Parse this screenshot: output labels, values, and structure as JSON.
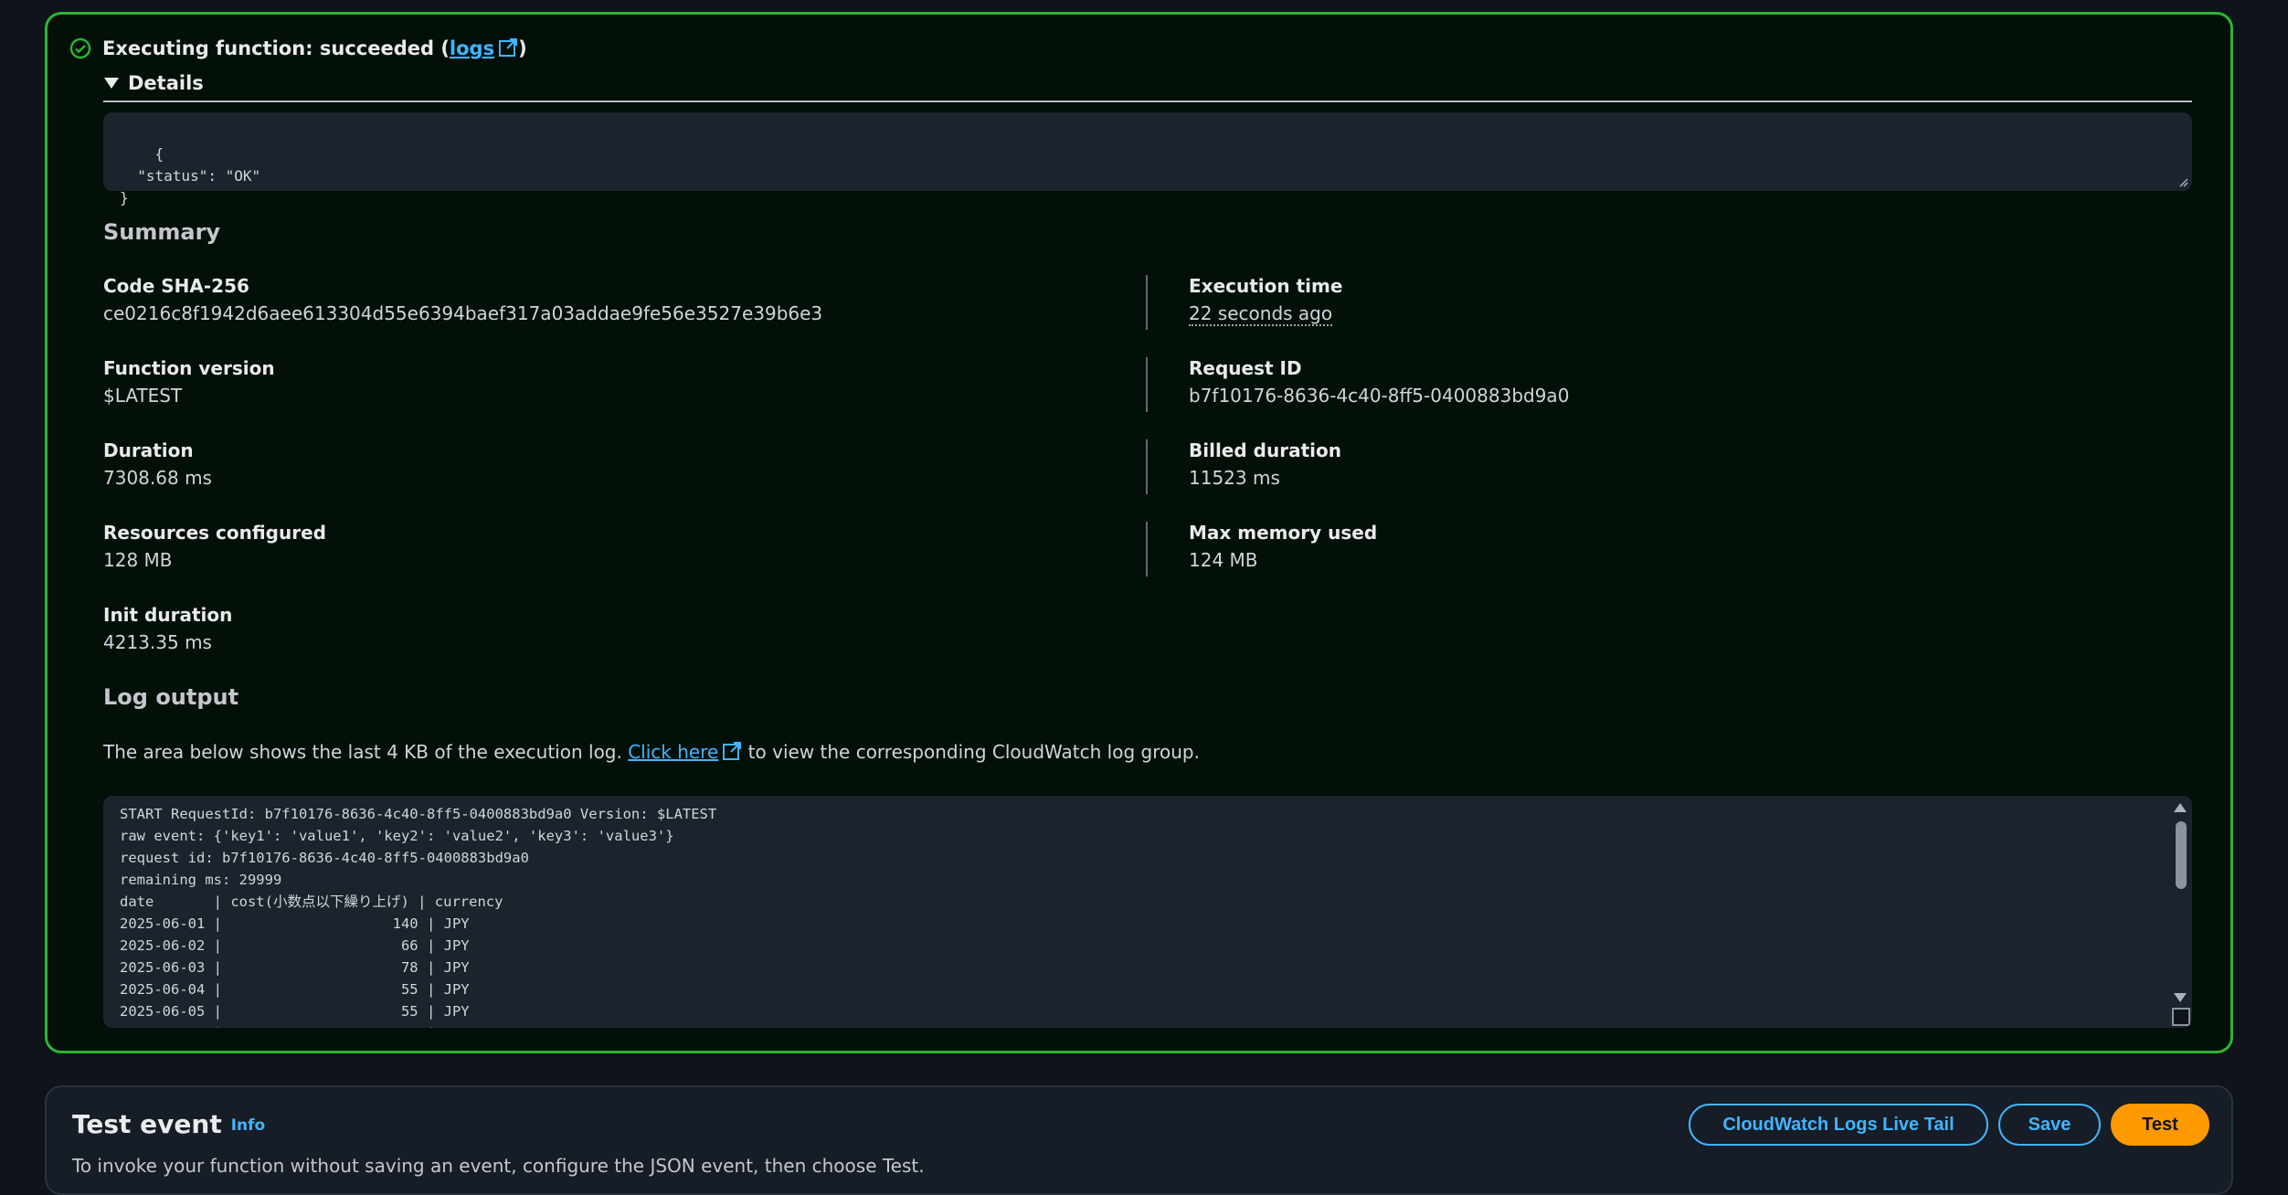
{
  "result": {
    "status_prefix": "Executing function: succeeded (",
    "logs_link": "logs",
    "status_suffix": ")",
    "details_label": "Details",
    "json_output": "{\n  \"status\": \"OK\"\n}",
    "summary_heading": "Summary",
    "summary": {
      "code_sha_label": "Code SHA-256",
      "code_sha_value": "ce0216c8f1942d6aee613304d55e6394baef317a03addae9fe56e3527e39b6e3",
      "execution_time_label": "Execution time",
      "execution_time_value": "22 seconds ago",
      "function_version_label": "Function version",
      "function_version_value": "$LATEST",
      "request_id_label": "Request ID",
      "request_id_value": "b7f10176-8636-4c40-8ff5-0400883bd9a0",
      "duration_label": "Duration",
      "duration_value": "7308.68 ms",
      "billed_duration_label": "Billed duration",
      "billed_duration_value": "11523 ms",
      "resources_label": "Resources configured",
      "resources_value": "128 MB",
      "max_memory_label": "Max memory used",
      "max_memory_value": "124 MB",
      "init_duration_label": "Init duration",
      "init_duration_value": "4213.35 ms"
    },
    "log_heading": "Log output",
    "log_desc_prefix": "The area below shows the last 4 KB of the execution log.",
    "log_desc_link": "Click here",
    "log_desc_suffix": "to view the corresponding CloudWatch log group.",
    "log_text": "START RequestId: b7f10176-8636-4c40-8ff5-0400883bd9a0 Version: $LATEST\nraw event: {'key1': 'value1', 'key2': 'value2', 'key3': 'value3'}\nrequest id: b7f10176-8636-4c40-8ff5-0400883bd9a0\nremaining ms: 29999\ndate       | cost(小数点以下繰り上げ) | currency\n2025-06-01 |                    140 | JPY\n2025-06-02 |                     66 | JPY\n2025-06-03 |                     78 | JPY\n2025-06-04 |                     55 | JPY\n2025-06-05 |                     55 | JPY\n           |                        |"
  },
  "test_event": {
    "title": "Test event",
    "info_link": "Info",
    "description": "To invoke your function without saving an event, configure the JSON event, then choose Test.",
    "live_tail_button": "CloudWatch Logs Live Tail",
    "save_button": "Save",
    "test_button": "Test"
  },
  "colors": {
    "success_border": "#2bb534",
    "link": "#42b4ff",
    "primary_button": "#ff9900"
  }
}
